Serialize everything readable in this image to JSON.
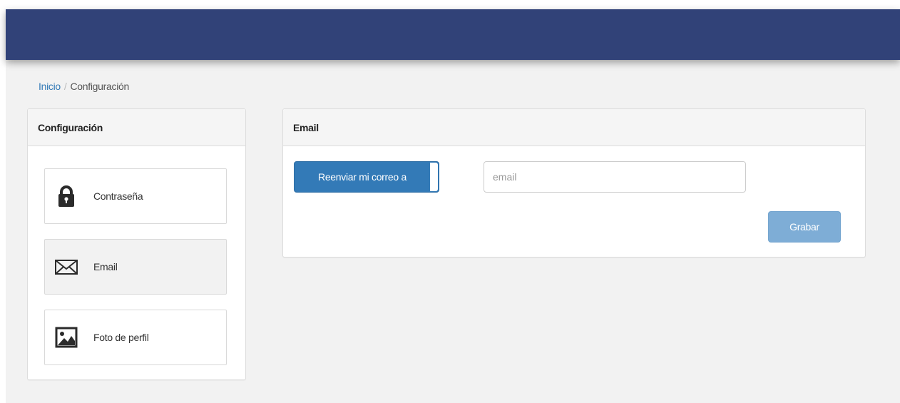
{
  "breadcrumb": {
    "home": "Inicio",
    "separator": "/",
    "current": "Configuración"
  },
  "left_panel": {
    "title": "Configuración",
    "items": [
      {
        "label": "Contraseña",
        "icon": "lock-icon",
        "active": false
      },
      {
        "label": "Email",
        "icon": "envelope-icon",
        "active": true
      },
      {
        "label": "Foto de perfil",
        "icon": "image-icon",
        "active": false
      }
    ]
  },
  "email_panel": {
    "title": "Email",
    "forward_label": "Reenviar mi correo a",
    "email_placeholder": "email",
    "email_value": "",
    "save_label": "Grabar"
  },
  "colors": {
    "topbar": "#314278",
    "primary": "#337ab7",
    "primary_disabled": "#7eadd6",
    "link": "#337ab7",
    "background": "#f2f2f2"
  }
}
